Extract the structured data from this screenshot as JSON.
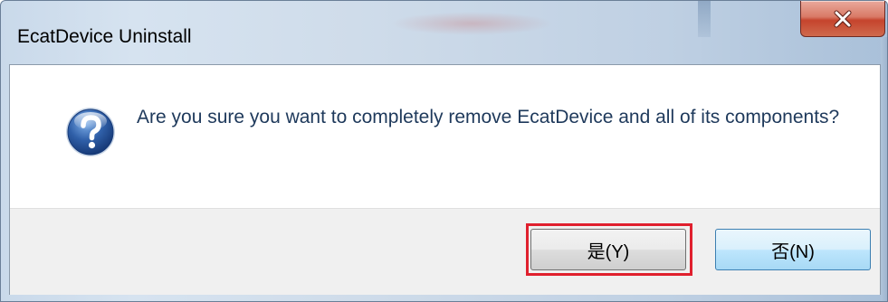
{
  "window": {
    "title": "EcatDevice Uninstall"
  },
  "titlebar": {
    "close_icon": "close-x-icon"
  },
  "dialog": {
    "icon": "question-icon",
    "message": "Are you sure you want to completely remove EcatDevice and all of its components?"
  },
  "buttons": {
    "yes_label": "是(Y)",
    "no_label": "否(N)"
  },
  "colors": {
    "focus_highlight": "#e0202e",
    "close_button": "#c5442d",
    "question_icon": "#2f5fa8",
    "message_text": "#1e395b"
  }
}
